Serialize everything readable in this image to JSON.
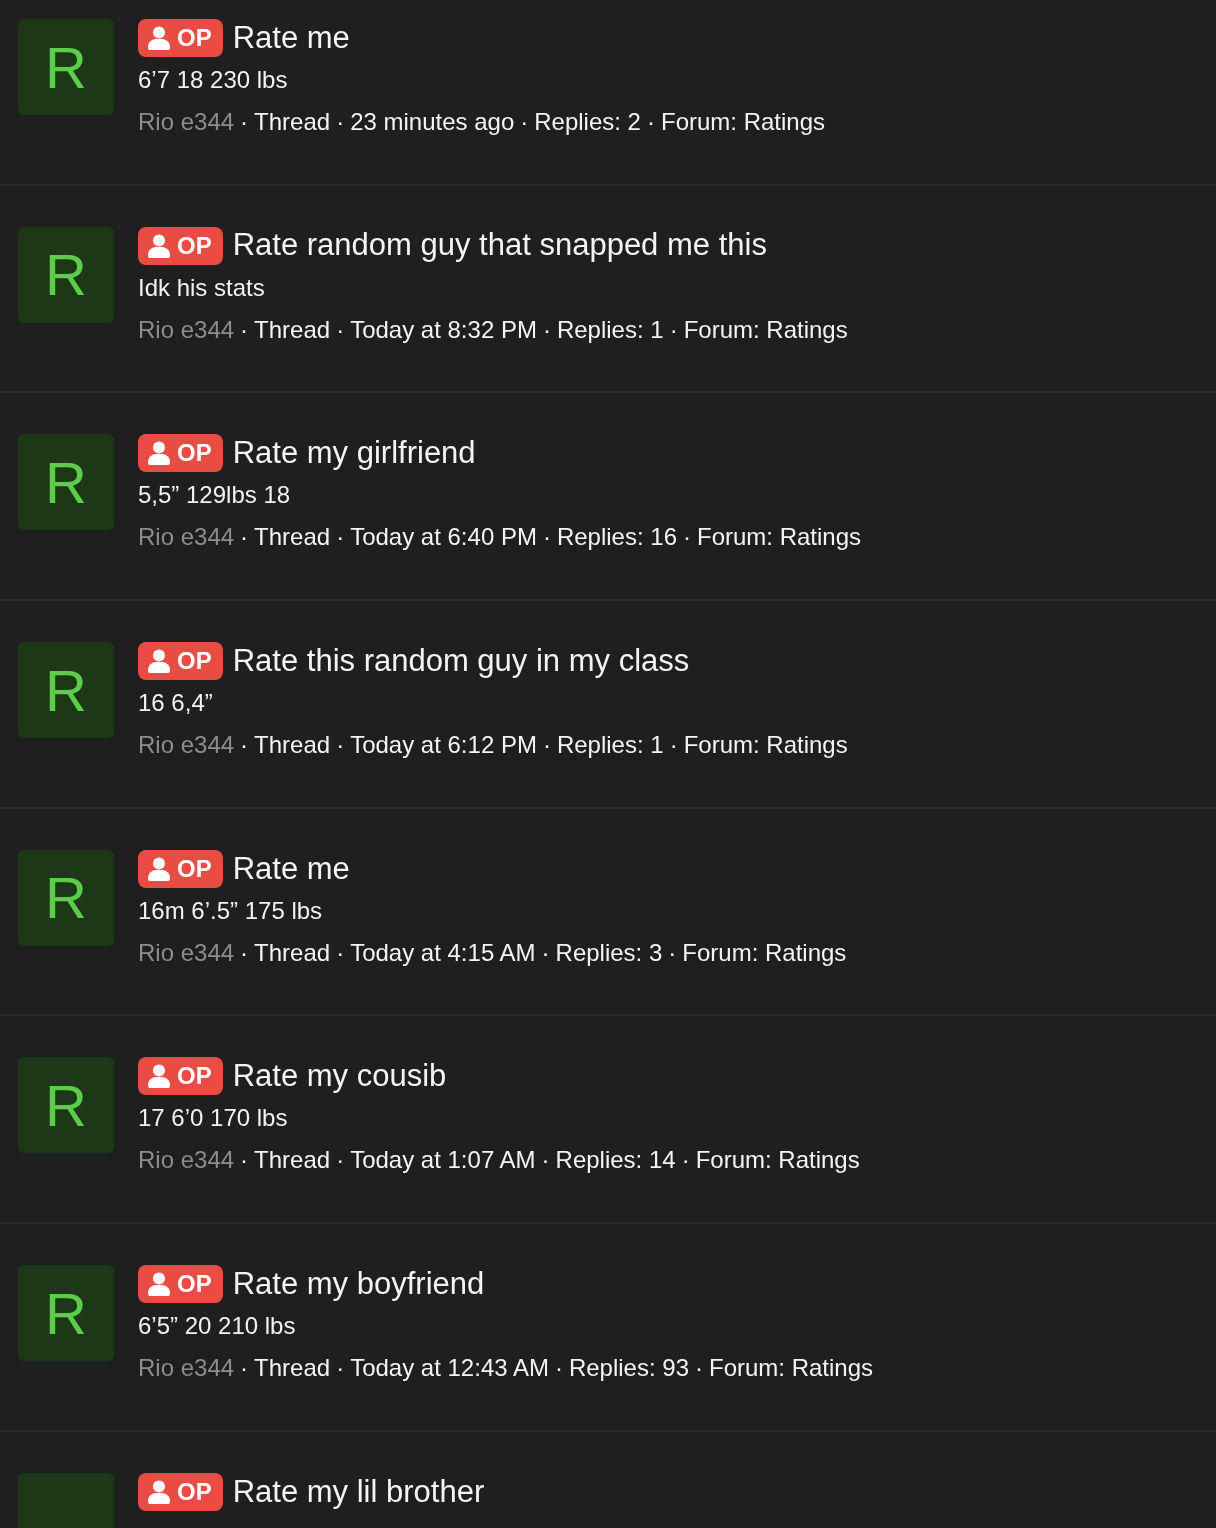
{
  "separator": "·",
  "threads": [
    {
      "avatar": "R",
      "badge": "OP",
      "title": "Rate me",
      "snippet": "6’7 18 230 lbs",
      "author": "Rio e344",
      "type": "Thread",
      "time": "23 minutes ago",
      "replies": "Replies: 2",
      "forum": "Forum: Ratings"
    },
    {
      "avatar": "R",
      "badge": "OP",
      "title": "Rate random guy that snapped me this",
      "snippet": "Idk his stats",
      "author": "Rio e344",
      "type": "Thread",
      "time": "Today at 8:32 PM",
      "replies": "Replies: 1",
      "forum": "Forum: Ratings"
    },
    {
      "avatar": "R",
      "badge": "OP",
      "title": "Rate my girlfriend",
      "snippet": "5,5” 129lbs 18",
      "author": "Rio e344",
      "type": "Thread",
      "time": "Today at 6:40 PM",
      "replies": "Replies: 16",
      "forum": "Forum: Ratings"
    },
    {
      "avatar": "R",
      "badge": "OP",
      "title": "Rate this random guy in my class",
      "snippet": "16 6,4”",
      "author": "Rio e344",
      "type": "Thread",
      "time": "Today at 6:12 PM",
      "replies": "Replies: 1",
      "forum": "Forum: Ratings"
    },
    {
      "avatar": "R",
      "badge": "OP",
      "title": "Rate me",
      "snippet": "16m 6’.5” 175 lbs",
      "author": "Rio e344",
      "type": "Thread",
      "time": "Today at 4:15 AM",
      "replies": "Replies: 3",
      "forum": "Forum: Ratings"
    },
    {
      "avatar": "R",
      "badge": "OP",
      "title": "Rate my cousib",
      "snippet": "17 6’0 170 lbs",
      "author": "Rio e344",
      "type": "Thread",
      "time": "Today at 1:07 AM",
      "replies": "Replies: 14",
      "forum": "Forum: Ratings"
    },
    {
      "avatar": "R",
      "badge": "OP",
      "title": "Rate my boyfriend",
      "snippet": "6’5” 20 210 lbs",
      "author": "Rio e344",
      "type": "Thread",
      "time": "Today at 12:43 AM",
      "replies": "Replies: 93",
      "forum": "Forum: Ratings"
    },
    {
      "badge": "OP",
      "title": "Rate my lil brother"
    }
  ]
}
